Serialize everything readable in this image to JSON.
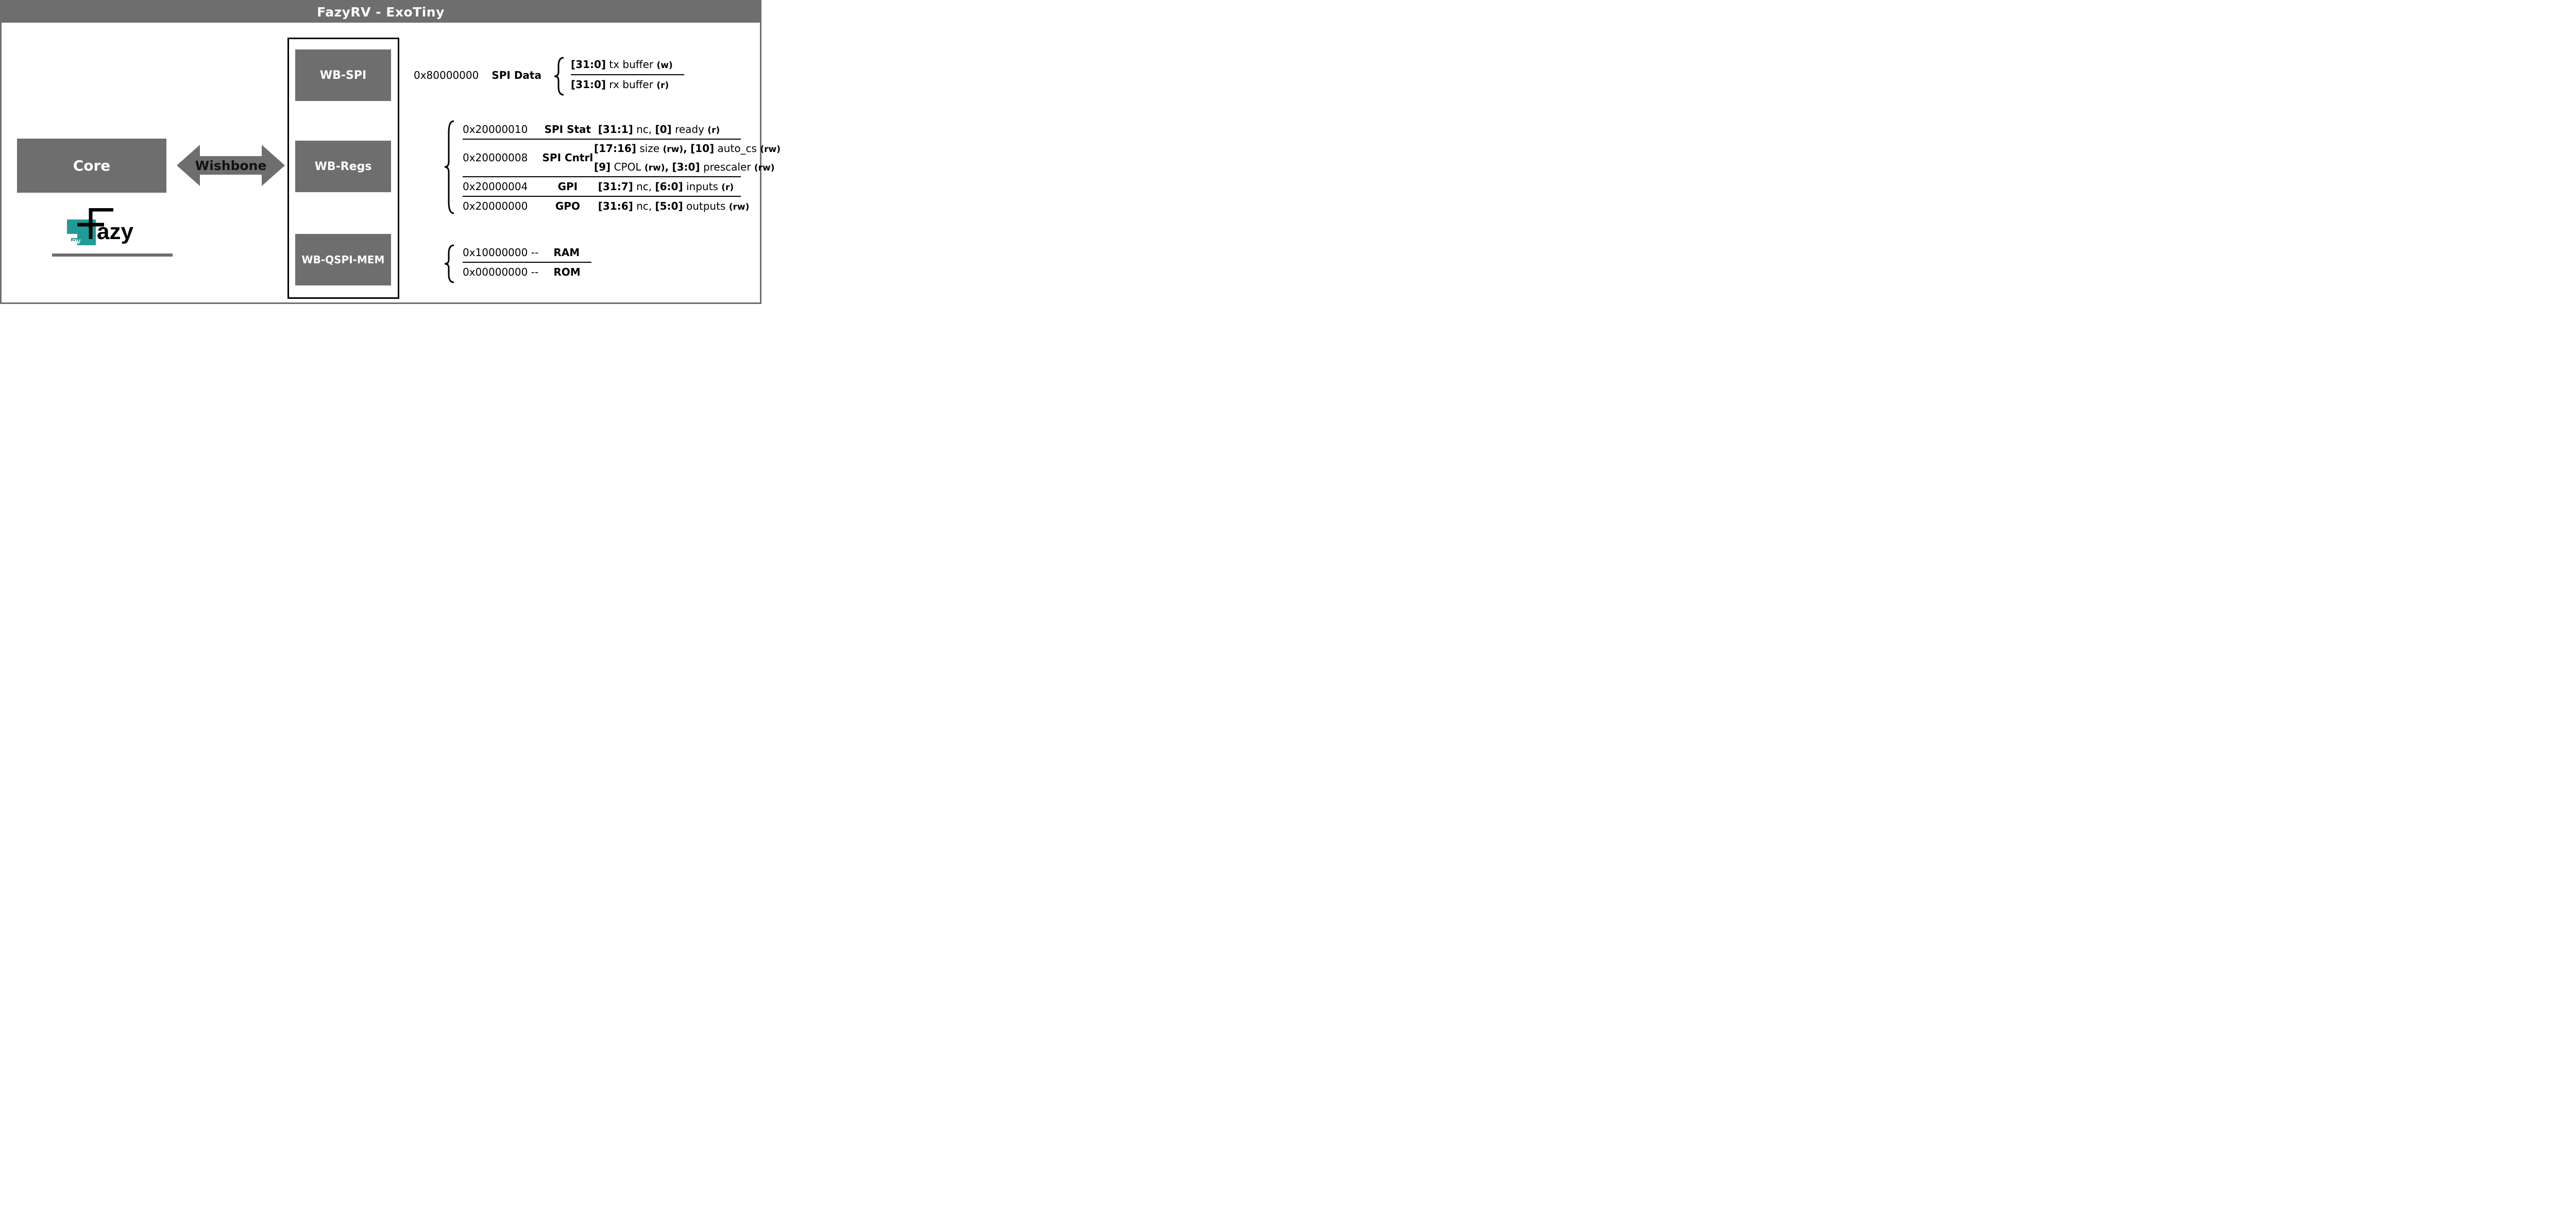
{
  "title": "FazyRV - ExoTiny",
  "core_label": "Core",
  "arrow_label": "Wishbone",
  "logo_text": {
    "main": "azy",
    "rv": "RV"
  },
  "peripherals": {
    "spi": "WB-SPI",
    "regs": "WB-Regs",
    "mem": "WB-QSPI-MEM"
  },
  "spi_data": {
    "addr": "0x80000000",
    "name": "SPI Data",
    "line1_bits": "[31:0]",
    "line1_txt": "tx buffer",
    "line1_acc": "(w)",
    "line2_bits": "[31:0]",
    "line2_txt": "rx buffer",
    "line2_acc": "(r)"
  },
  "regs": {
    "spi_stat": {
      "addr": "0x20000010",
      "name": "SPI Stat",
      "b1": "[31:1]",
      "t1": "nc,",
      "b2": "[0]",
      "t2": "ready",
      "a2": "(r)"
    },
    "spi_cntrl": {
      "addr": "0x20000008",
      "name": "SPI Cntrl",
      "l1b1": "[17:16]",
      "l1t1": "size",
      "l1a1": "(rw)",
      "l1b2": "[10]",
      "l1t2": "auto_cs",
      "l1a2": "(rw)",
      "l2b1": "[9]",
      "l2t1": "CPOL",
      "l2a1": "(rw)",
      "l2b2": "[3:0]",
      "l2t2": "prescaler",
      "l2a2": "(rw)"
    },
    "gpi": {
      "addr": "0x20000004",
      "name": "GPI",
      "b1": "[31:7]",
      "t1": "nc,",
      "b2": "[6:0]",
      "t2": "inputs",
      "a2": "(r)"
    },
    "gpo": {
      "addr": "0x20000000",
      "name": "GPO",
      "b1": "[31:6]",
      "t1": "nc,",
      "b2": "[5:0]",
      "t2": "outputs",
      "a2": "(rw)"
    }
  },
  "mem": {
    "ram": {
      "addr": "0x10000000 --",
      "name": "RAM"
    },
    "rom": {
      "addr": "0x00000000 --",
      "name": "ROM"
    }
  }
}
